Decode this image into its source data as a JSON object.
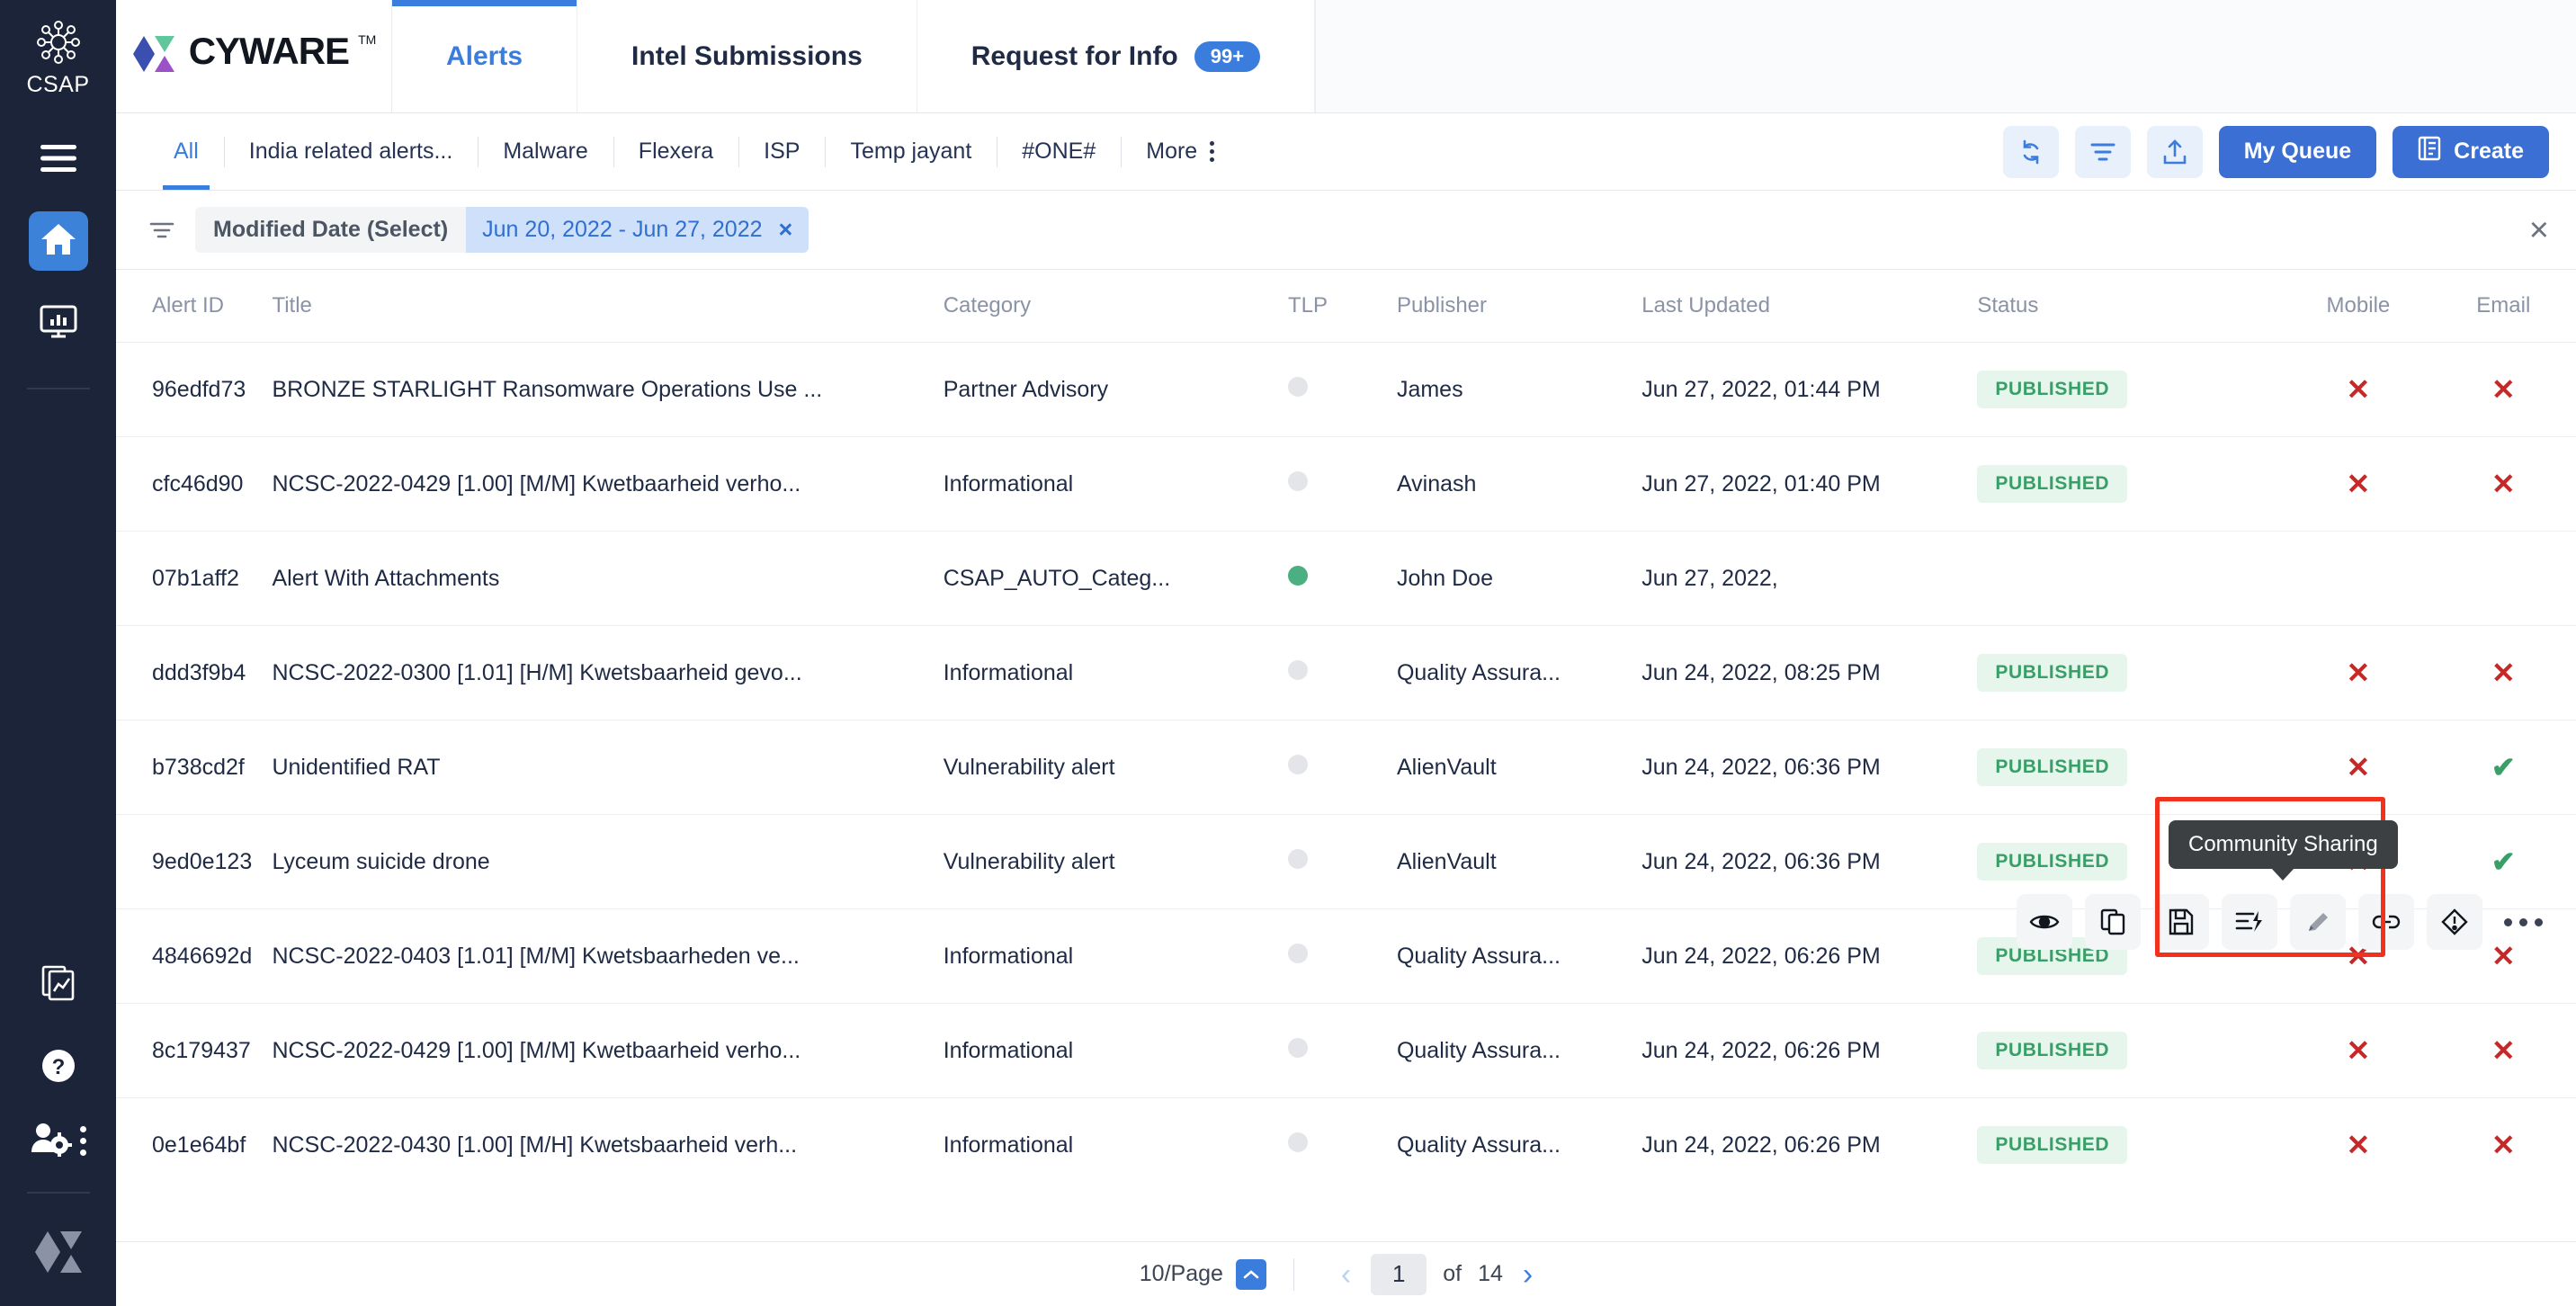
{
  "rail": {
    "product_label": "CSAP",
    "items": [
      {
        "name": "menu-icon",
        "label": "Menu"
      },
      {
        "name": "home-icon",
        "label": "Home",
        "active": true
      },
      {
        "name": "dashboard-icon",
        "label": "Dashboard"
      }
    ],
    "bottom_items": [
      {
        "name": "reports-icon",
        "label": "Reports"
      },
      {
        "name": "help-icon",
        "label": "Help"
      },
      {
        "name": "user-settings-icon",
        "label": "User Settings"
      },
      {
        "name": "cyware-mark-icon",
        "label": "Cyware"
      }
    ]
  },
  "brand": {
    "word": "CYWARE",
    "tm": "TM"
  },
  "top_tabs": [
    {
      "label": "Alerts",
      "active": true,
      "badge": ""
    },
    {
      "label": "Intel Submissions",
      "active": false,
      "badge": ""
    },
    {
      "label": "Request for Info",
      "active": false,
      "badge": "99+"
    }
  ],
  "subnav": {
    "tabs": [
      {
        "label": "All",
        "active": true
      },
      {
        "label": "India related alerts...",
        "active": false
      },
      {
        "label": "Malware",
        "active": false
      },
      {
        "label": "Flexera",
        "active": false
      },
      {
        "label": "ISP",
        "active": false
      },
      {
        "label": "Temp jayant",
        "active": false
      },
      {
        "label": "#ONE#",
        "active": false
      },
      {
        "label": "More",
        "active": false,
        "kebab": true
      }
    ],
    "actions": [
      {
        "name": "refresh-icon",
        "label": "Refresh"
      },
      {
        "name": "filter-icon",
        "label": "Filter"
      },
      {
        "name": "export-icon",
        "label": "Export"
      }
    ],
    "my_queue_label": "My Queue",
    "create_label": "Create"
  },
  "filterbar": {
    "chip_label": "Modified Date (Select)",
    "chip_value": "Jun 20, 2022 - Jun 27, 2022",
    "chip_remove": "×",
    "close": "×"
  },
  "table": {
    "columns": [
      "Alert ID",
      "Title",
      "Category",
      "TLP",
      "Publisher",
      "Last Updated",
      "Status",
      "Mobile",
      "Email"
    ],
    "rows": [
      {
        "id": "96edfd73",
        "title": "BRONZE STARLIGHT Ransomware Operations Use ...",
        "category": "Partner Advisory",
        "tlp": "grey",
        "publisher": "James",
        "updated": "Jun 27, 2022, 01:44 PM",
        "status": "PUBLISHED",
        "mobile": "x",
        "email": "x"
      },
      {
        "id": "cfc46d90",
        "title": "NCSC-2022-0429 [1.00] [M/M] Kwetbaarheid verho...",
        "category": "Informational",
        "tlp": "grey",
        "publisher": "Avinash",
        "updated": "Jun 27, 2022, 01:40 PM",
        "status": "PUBLISHED",
        "mobile": "x",
        "email": "x"
      },
      {
        "id": "07b1aff2",
        "title": "Alert With Attachments",
        "category": "CSAP_AUTO_Categ...",
        "tlp": "green",
        "publisher": "John Doe",
        "updated": "Jun 27, 2022,",
        "status": "",
        "mobile": "",
        "email": ""
      },
      {
        "id": "ddd3f9b4",
        "title": "NCSC-2022-0300 [1.01] [H/M] Kwetsbaarheid gevo...",
        "category": "Informational",
        "tlp": "grey",
        "publisher": "Quality Assura...",
        "updated": "Jun 24, 2022, 08:25 PM",
        "status": "PUBLISHED",
        "mobile": "x",
        "email": "x"
      },
      {
        "id": "b738cd2f",
        "title": "Unidentified RAT",
        "category": "Vulnerability alert",
        "tlp": "grey",
        "publisher": "AlienVault",
        "updated": "Jun 24, 2022, 06:36 PM",
        "status": "PUBLISHED",
        "mobile": "x",
        "email": "v"
      },
      {
        "id": "9ed0e123",
        "title": "Lyceum suicide drone",
        "category": "Vulnerability alert",
        "tlp": "grey",
        "publisher": "AlienVault",
        "updated": "Jun 24, 2022, 06:36 PM",
        "status": "PUBLISHED",
        "mobile": "x",
        "email": "v"
      },
      {
        "id": "4846692d",
        "title": "NCSC-2022-0403 [1.01] [M/M] Kwetsbaarheden ve...",
        "category": "Informational",
        "tlp": "grey",
        "publisher": "Quality Assura...",
        "updated": "Jun 24, 2022, 06:26 PM",
        "status": "PUBLISHED",
        "mobile": "x",
        "email": "x"
      },
      {
        "id": "8c179437",
        "title": "NCSC-2022-0429 [1.00] [M/M] Kwetbaarheid verho...",
        "category": "Informational",
        "tlp": "grey",
        "publisher": "Quality Assura...",
        "updated": "Jun 24, 2022, 06:26 PM",
        "status": "PUBLISHED",
        "mobile": "x",
        "email": "x"
      },
      {
        "id": "0e1e64bf",
        "title": "NCSC-2022-0430 [1.00] [M/H] Kwetsbaarheid verh...",
        "category": "Informational",
        "tlp": "grey",
        "publisher": "Quality Assura...",
        "updated": "Jun 24, 2022, 06:26 PM",
        "status": "PUBLISHED",
        "mobile": "x",
        "email": "x"
      }
    ]
  },
  "row_actions": {
    "tooltip": "Community Sharing",
    "icons": [
      {
        "name": "preview-eye-icon",
        "label": "Preview"
      },
      {
        "name": "duplicate-icon",
        "label": "Duplicate"
      },
      {
        "name": "save-icon",
        "label": "Save"
      },
      {
        "name": "community-sharing-icon",
        "label": "Community Sharing"
      },
      {
        "name": "edit-pencil-icon",
        "label": "Edit"
      },
      {
        "name": "link-icon",
        "label": "Link"
      },
      {
        "name": "report-incident-icon",
        "label": "Report Incident"
      },
      {
        "name": "more-options-icon",
        "label": "More"
      }
    ]
  },
  "pager": {
    "per_page": "10/Page",
    "prev": "‹",
    "current_page": "1",
    "of": "of",
    "total_pages": "14",
    "next": "›"
  },
  "colors": {
    "accent": "#3b7ddd",
    "rail_bg": "#1b2438",
    "published_text": "#3a9e68",
    "published_bg": "#e6f6ec",
    "danger": "#c62828",
    "highlight": "#f0321e"
  }
}
